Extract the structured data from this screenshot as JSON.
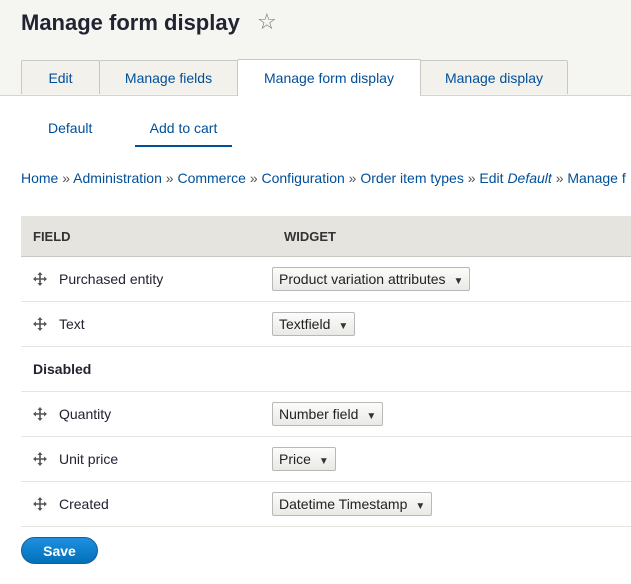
{
  "page": {
    "title": "Manage form display",
    "star_icon": "star-outline-icon"
  },
  "tabs": [
    {
      "label": "Edit",
      "active": false
    },
    {
      "label": "Manage fields",
      "active": false
    },
    {
      "label": "Manage form display",
      "active": true
    },
    {
      "label": "Manage display",
      "active": false
    }
  ],
  "subtabs": [
    {
      "label": "Default",
      "active": false
    },
    {
      "label": "Add to cart",
      "active": true
    }
  ],
  "breadcrumb": {
    "items": [
      "Home",
      "Administration",
      "Commerce",
      "Configuration",
      "Order item types",
      "Edit"
    ],
    "edit_target": "Default",
    "last": "Manage f",
    "separator": "»"
  },
  "table": {
    "headers": {
      "field": "FIELD",
      "widget": "WIDGET"
    },
    "enabled_rows": [
      {
        "field": "Purchased entity",
        "widget": "Product variation attributes"
      },
      {
        "field": "Text",
        "widget": "Textfield"
      }
    ],
    "disabled_region": "Disabled",
    "disabled_rows": [
      {
        "field": "Quantity",
        "widget": "Number field"
      },
      {
        "field": "Unit price",
        "widget": "Price"
      },
      {
        "field": "Created",
        "widget": "Datetime Timestamp"
      }
    ]
  },
  "actions": {
    "save_label": "Save"
  },
  "colors": {
    "link": "#004f99",
    "primary_button": "#0071b8",
    "header_bg": "#f5f5f2"
  }
}
